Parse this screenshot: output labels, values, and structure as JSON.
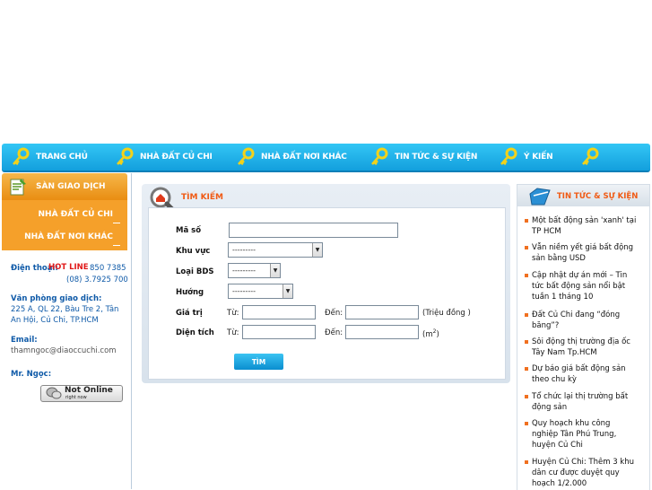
{
  "nav": {
    "items": [
      "TRANG CHỦ",
      "NHÀ ĐẤT CỦ CHI",
      "NHÀ ĐẤT NƠI KHÁC",
      "TIN TỨC & SỰ KIỆN",
      "Ý KIẾN"
    ],
    "icon": "key-icon"
  },
  "left": {
    "title": "SÀN GIAO DỊCH",
    "links": [
      "NHÀ ĐẤT CỦ CHI",
      "NHÀ ĐẤT NƠI KHÁC"
    ],
    "phone_label": "Điện thoại:",
    "hotline": "HOT LINE",
    "phone1": "850 7385",
    "phone2": "(08) 3.7925 700",
    "office_label": "Văn phòng giao dịch:",
    "address": "225 A, QL 22, Bàu Tre 2, Tân An Hội, Củ Chi, TP.HCM",
    "email_label": "Email:",
    "email": "thamngoc@diaoccuchi.com",
    "person": "Mr. Ngọc:",
    "status_main": "Not Online",
    "status_sub": "right now"
  },
  "search": {
    "title": "TÌM KIẾM",
    "labels": {
      "code": "Mã số",
      "area": "Khu vực",
      "type": "Loại BDS",
      "direction": "Hướng",
      "price": "Giá trị",
      "size": "Diện tích"
    },
    "select_default": "---------",
    "from": "Từ:",
    "to": "Đến:",
    "price_unit": "(Triệu đồng )",
    "area_unit": "(m",
    "area_unit_sup": "2",
    "area_unit_close": ")",
    "button": "TÌM"
  },
  "news": {
    "title": "TIN TỨC & SỰ KIỆN",
    "items": [
      "Một bất động sản 'xanh' tại TP HCM",
      "Vẫn niềm yết giá bất động sản bằng USD",
      "Cập nhật dự án mới – Tin tức bất động sản nổi bật tuần 1 tháng 10",
      "Đất Củ Chi đang “đóng băng”?",
      "Sôi động thị trường địa ốc Tây Nam Tp.HCM",
      "Dự báo giá bất động sản theo chu kỳ",
      "Tổ chức lại thị trường bất động sản",
      "Quy hoạch khu công nghiệp Tân Phú Trung, huyện Củ Chi",
      "Huyện Củ Chi: Thêm 3 khu dân cư được duyệt quy hoạch 1/2.000"
    ]
  },
  "colors": {
    "nav": "#1aaee6",
    "accent": "#f05a14",
    "left_menu": "#f5a02a",
    "link_blue": "#0f5aa8"
  }
}
